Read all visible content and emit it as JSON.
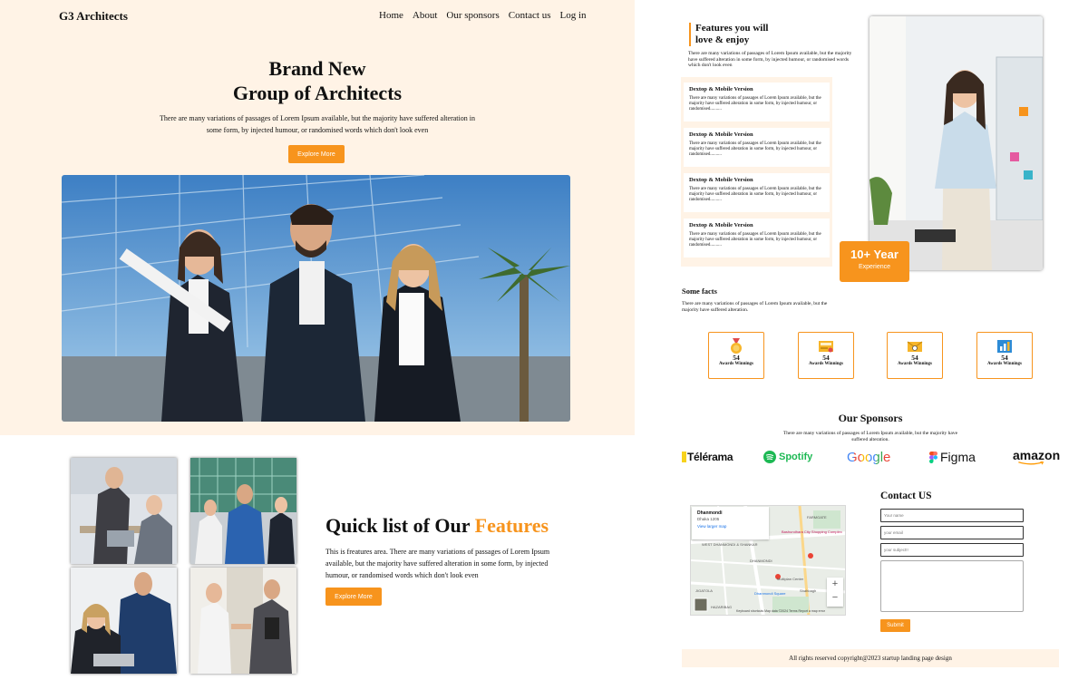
{
  "brand": {
    "logo": "G3 Architects"
  },
  "nav": {
    "items": [
      "Home",
      "About",
      "Our sponsors",
      "Contact us",
      "Log in"
    ]
  },
  "hero": {
    "title_line1": "Brand New",
    "title_line2": "Group of Architects",
    "description": "There are many variations of passages of Lorem Ipsum available, but the majority have suffered alteration in some form, by injected humour, or randomised words which don't look even",
    "button": "Explore More"
  },
  "quick": {
    "title_main": "Quick list of Our ",
    "title_accent": "Features",
    "description": "This is freatures area. There are many variations of passages of Lorem Ipsum available, but the majority have suffered alteration in some form, by injected humour, or randomised words which don't look even",
    "button": "Explore More"
  },
  "features": {
    "title_line1": "Features you will",
    "title_line2": "love & enjoy",
    "description": "There are many variations of passages of Lorem Ipsum available, but the majority have suffered alteration in some form, by injected humour, or randomised words which don't look even",
    "cards": [
      {
        "title": "Dextop & Mobile Version",
        "text": "There are many variations of passages of Lorem Ipsum available, but the majority have suffered alteration in some form, by injected humour, or randomised.........."
      },
      {
        "title": "Dextop & Mobile Version",
        "text": "There are many variations of passages of Lorem Ipsum available, but the majority have suffered alteration in some form, by injected humour, or randomised.........."
      },
      {
        "title": "Dextop & Mobile Version",
        "text": "There are many variations of passages of Lorem Ipsum available, but the majority have suffered alteration in some form, by injected humour, or randomised.........."
      },
      {
        "title": "Dextop & Mobile Version",
        "text": "There are many variations of passages of Lorem Ipsum available, but the majority have suffered alteration in some form, by injected humour, or randomised.........."
      }
    ],
    "experience": {
      "value": "10+ Year",
      "label": "Experience"
    }
  },
  "facts": {
    "title": "Some facts",
    "description": "There are many variations of passages of Lorem Ipsum available, but the majority have suffered alteration.",
    "awards": [
      {
        "icon": "medal-icon",
        "number": "54",
        "label": "Awards Winnings"
      },
      {
        "icon": "certificate-icon",
        "number": "54",
        "label": "Awards Winnings"
      },
      {
        "icon": "email-icon",
        "number": "54",
        "label": "Awards Winnings"
      },
      {
        "icon": "chart-icon",
        "number": "54",
        "label": "Awards Winnings"
      }
    ]
  },
  "sponsors": {
    "title": "Our Sponsors",
    "description": "There are many variations of passages of Lorem Ipsum available, but the majority have suffered alteration.",
    "logos": [
      "Télérama",
      "Spotify",
      "Google",
      "Figma",
      "amazon"
    ]
  },
  "map": {
    "place": "Dhanmondi",
    "address": "Dhaka 1205",
    "link": "View larger map",
    "labels": [
      "FARMGATE",
      "Bashundhara City Shopping Complex",
      "WEST DHANMONDI & SHANKAR",
      "DHANMONDI",
      "Multiplan Center",
      "Shahbagh",
      "Dhanmondi Square",
      "JIGATOLA",
      "HAZARIBAG"
    ],
    "footer": "Keyboard shortcuts   Map data ©2024   Terms   Report a map error"
  },
  "contact": {
    "title": "Contact US",
    "name_placeholder": "Your name",
    "email_placeholder": "your email",
    "subject_placeholder": "your subject!!",
    "submit": "Submit"
  },
  "footer": {
    "text": "All rights reserved copyright@2023 startup landing page design"
  },
  "colors": {
    "accent": "#f7941d",
    "cream": "#fff3e6"
  }
}
